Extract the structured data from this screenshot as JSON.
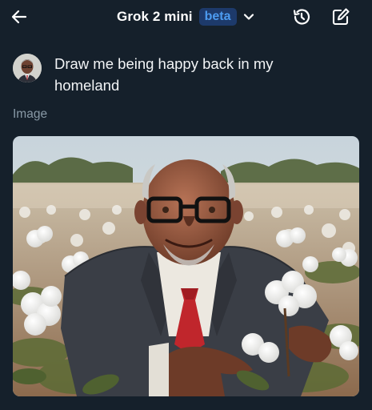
{
  "header": {
    "model_name": "Grok 2 mini",
    "badge": "beta",
    "icons": {
      "back": "arrow-left-icon",
      "dropdown": "chevron-down-icon",
      "history": "history-icon",
      "new_chat": "edit-icon"
    }
  },
  "conversation": {
    "user_message": "Draw me being happy back in my homeland",
    "response_label": "Image"
  },
  "colors": {
    "background": "#15202b",
    "accent": "#4c9bf0",
    "muted_text": "#8899a6"
  }
}
